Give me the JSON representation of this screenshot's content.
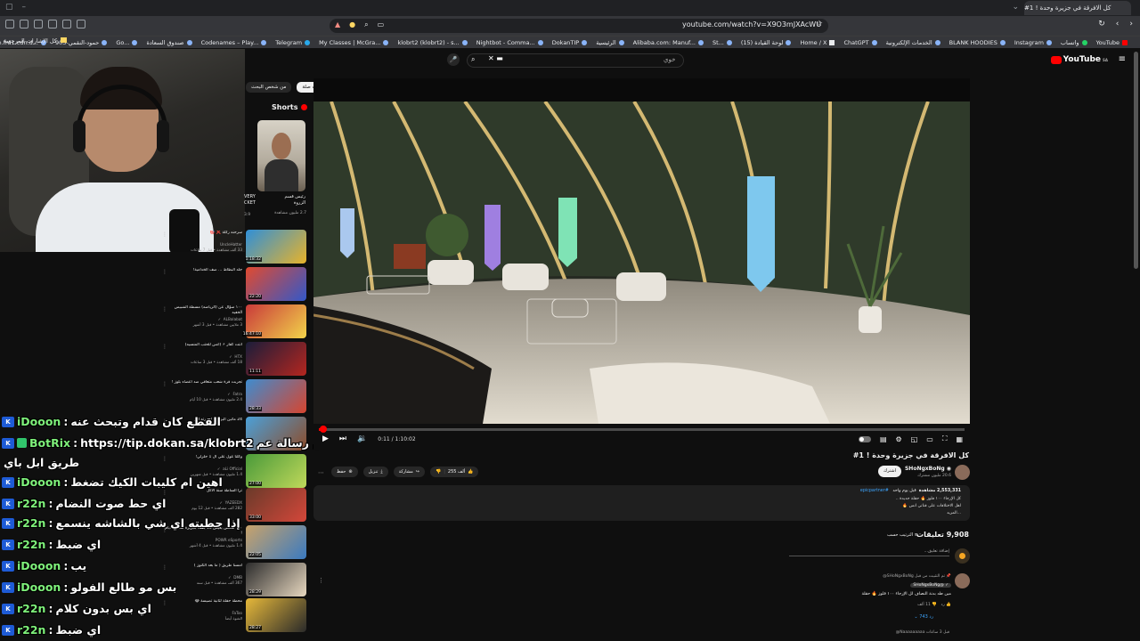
{
  "browser": {
    "tab_title": "كل الافرقة في جزيرة وحدة ! 1#",
    "url": "youtube.com/watch?v=X9O3mJXAcWU",
    "bookmarks_folder": "كل الإشارات المرجعية",
    "bookmarks": [
      "YouTube",
      "واتساب",
      "Instagram",
      "BLANK HOODIES",
      "الخدمات الإلكترونية",
      "ChatGPT",
      "Home / X",
      "(15) لوحة القيادة",
      "St...",
      "Alibaba.com: Manuf...",
      "الرئيسية",
      "DokanTIP",
      "Nightbot - Comma...",
      "klobrt2 (klobrt2) - s...",
      "My Classes | McGra...",
      "Telegram",
      "Codenames – Play...",
      "صندوق السعادة",
      "Go...",
      "903-حمود-النقمي",
      "codebase.fra1.cdn.d..."
    ]
  },
  "youtube": {
    "logo": "YouTube",
    "logo_sup": "SA",
    "search_query": "خوي",
    "chips": [
      "من شخص البحث",
      "ذات صلة"
    ],
    "shorts_label": "Shorts",
    "short": {
      "title": "رئيس قسم الزروة",
      "views": "2.7 مليون مشاهدة",
      "cut_title": "VERY CKET",
      "cut_views": "3.9"
    }
  },
  "recs": [
    {
      "title": "سرحنه ركلة ❌ 🎯",
      "channel": "UncleHatter ‏",
      "meta": "‏33 ألف مشاهدة • قبل 7 ساعات",
      "duration": "1:18:32",
      "color": "#2f8fd8",
      "accent": "#e8b32a"
    },
    {
      "title": "جلد البطاط ... صف الخدامية!",
      "channel": "",
      "meta": "",
      "duration": "22:20",
      "color": "#e14a2f",
      "accent": "#3358c9"
    },
    {
      "title": "١٠٠ سؤال عن (الرياضه) مسطة الشبيس الخفيه",
      "channel": "ALBalabat ‏ ✓",
      "meta": "3 ملايين مشاهدة • قبل 3 أشهر",
      "duration": "16:47:10",
      "color": "#c93a3a",
      "accent": "#f2d34a"
    },
    {
      "title": "انتت كفار ⚡ (أنس للحتب المنسيه)",
      "channel": "HTX ‏ ✓",
      "meta": "18 ألف مشاهدة • قبل 3 ساعات",
      "duration": "11:11",
      "color": "#1b1d3a",
      "accent": "#b4261f"
    },
    {
      "title": "تجربت قرة شعب متعاقي ضد اعضاء بلوز !",
      "channel": "Fatra ‏ ✓",
      "meta": "2.4 مليون مشاهدة • قبل 10 أيام",
      "duration": "28:33",
      "color": "#3e8ccf",
      "accent": "#d7452f"
    },
    {
      "title": "24 ماتين اليزار 8 أشيرته أفر",
      "channel": "",
      "meta": "",
      "duration": "",
      "color": "#4ba0d8",
      "accent": "#8d4c2a"
    },
    {
      "title": "وكلنا غول علي ال 1 حلزلي!",
      "channel": "aLi Official ‏ ✓",
      "meta": "1.4 مليون مشاهدة • قبل شهرين",
      "duration": "27:00",
      "color": "#4a9a3a",
      "accent": "#c0d85a"
    },
    {
      "title": "تزا الساطة سنة الاكل",
      "channel": "YAZEEDX ‏ ✓",
      "meta": "282 ألف مشاهدة • قبل 12 يوم",
      "duration": "33:00",
      "color": "#6a3a2a",
      "accent": "#d4473a"
    },
    {
      "title": "١٠٠ شخص يعيش 10 بحت بجزيرة لمدة 7 أيام !",
      "channel": "POWR eSports ‏",
      "meta": "1.4 مليون مشاهدة • قبل 4 أشهر",
      "duration": "22:05",
      "color": "#c9a36a",
      "accent": "#3a7ac0"
    },
    {
      "title": "امسنا طريق ( ما بعد الكنوز )",
      "channel": "DMB ‏ ✓",
      "meta": "367 ألف مشاهدة • قبل سنة",
      "duration": "28:29",
      "color": "#2c2c2c",
      "accent": "#e8d8c0"
    },
    {
      "title": "محطة حفلة لثانية تضيسة 😂",
      "channel": "FaToo ‏",
      "meta": "الشوة أيضاً",
      "duration": "28:27",
      "color": "#e6b83a",
      "accent": "#2a2a2a"
    }
  ],
  "chat": [
    {
      "user": "iDooon",
      "message": "القطع كان قدام وتبحث عنه",
      "badge": "kb"
    },
    {
      "user": "BotRix",
      "message": "https://tip.dokan.sa/klobrt2",
      "badge": "ok",
      "trail": "عن رسالة عم"
    },
    {
      "user": "",
      "message": "طريق ابل باي",
      "badge": ""
    },
    {
      "user": "iDooon",
      "message": "اهين ام كليبات الكيك تضغط",
      "badge": "kb"
    },
    {
      "user": "r22n",
      "message": "اي حط صوت النضام",
      "badge": "kb"
    },
    {
      "user": "r22n",
      "message": "إذا حطيته اي شي بالشاشه ينسمع",
      "badge": "kb"
    },
    {
      "user": "r22n",
      "message": "اي ضبط",
      "badge": "kb"
    },
    {
      "user": "iDooon",
      "message": "يب",
      "badge": "kb"
    },
    {
      "user": "iDooon",
      "message": "بس مو طالع الفولو",
      "badge": "kb"
    },
    {
      "user": "r22n",
      "message": "اي بس بدون كلام",
      "badge": "kb"
    },
    {
      "user": "r22n",
      "message": "اي ضبط",
      "badge": "kb"
    }
  ],
  "player": {
    "time": "0:11 / 1:10:02",
    "progress": 0.003
  },
  "video": {
    "title": "كل الافرقة في جزيرة وحدة ! 1#",
    "channel": "SHoNgxBoNg",
    "subscribers": "20.6 مليون مشترك",
    "subscribe_label": "اشترك",
    "likes": "255 ألف",
    "share": "مشاركة",
    "download": "تنزيل",
    "save": "حفظ",
    "views": "2,553,331 مشاهدة",
    "date": "قبل يوم واحد",
    "hashtag": "#epicpartner",
    "desc_lines": [
      "كل الإرجاء ١٠٠ فلوز 🔥 حقلة جديدة ..",
      "اهل الاختلافات على قناتي انس 🔥",
      "...المزيد"
    ]
  },
  "comments": {
    "count": "9,908 تعليقات",
    "sort_label": "الترتيب حسب",
    "add_placeholder": "إضافة تعليق...",
    "pinned": "تم التثبيت من قبل SHoNgxBoNg@",
    "author": "SHoNgxBoNg@ ✓",
    "text": "مين طه بدنة النصاف لل الإرجاء ١٠٠ فلوز 🔥 حقلة",
    "likes": "11 ألف",
    "replies": "743 رد",
    "next_author": "@Naaaaaaaaa قبل 3 ساعات"
  }
}
